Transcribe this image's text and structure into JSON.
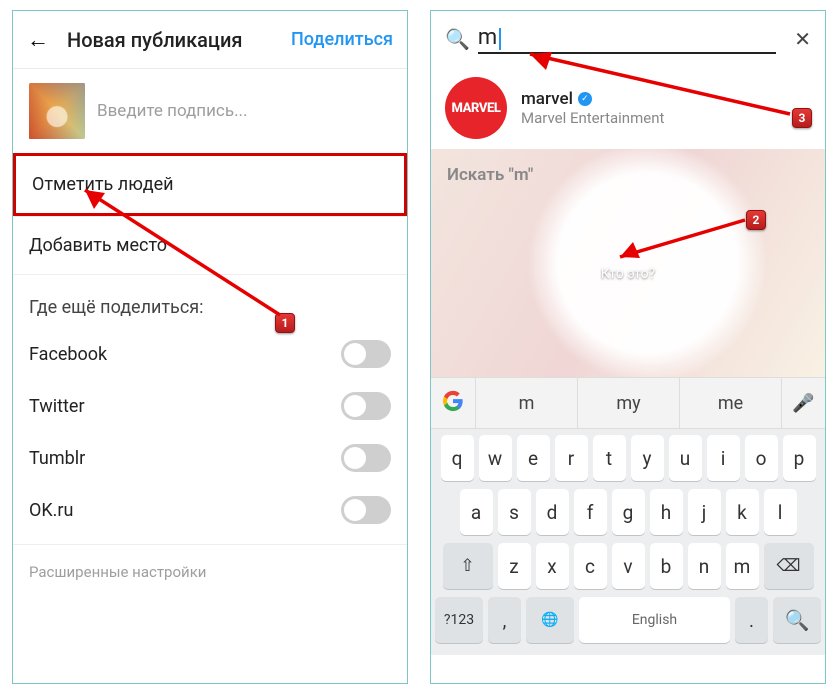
{
  "left": {
    "header": {
      "title": "Новая публикация",
      "share": "Поделиться"
    },
    "caption_placeholder": "Введите подпись...",
    "tag_people": "Отметить людей",
    "add_location": "Добавить место",
    "share_section": "Где ещё поделиться:",
    "share_targets": [
      {
        "name": "Facebook",
        "on": false
      },
      {
        "name": "Twitter",
        "on": false
      },
      {
        "name": "Tumblr",
        "on": false
      },
      {
        "name": "OK.ru",
        "on": false
      }
    ],
    "advanced": "Расширенные настройки"
  },
  "right": {
    "query": "m",
    "result": {
      "logo": "MARVEL",
      "username": "marvel",
      "fullname": "Marvel Entertainment"
    },
    "body_hint": "Искать \"m\"",
    "who_label": "Кто это?",
    "suggestions": [
      "m",
      "my",
      "me"
    ],
    "keyboard": {
      "row1": [
        "q",
        "w",
        "e",
        "r",
        "t",
        "y",
        "u",
        "i",
        "o",
        "p"
      ],
      "row2": [
        "a",
        "s",
        "d",
        "f",
        "g",
        "h",
        "j",
        "k",
        "l"
      ],
      "row3": [
        "z",
        "x",
        "c",
        "v",
        "b",
        "n",
        "m"
      ],
      "shift": "⇧",
      "backspace": "⌫",
      "sym": "?123",
      "comma": ",",
      "globe": "🌐",
      "space": "English",
      "dot": ".",
      "search": "🔍"
    }
  },
  "callouts": {
    "c1": "1",
    "c2": "2",
    "c3": "3"
  }
}
